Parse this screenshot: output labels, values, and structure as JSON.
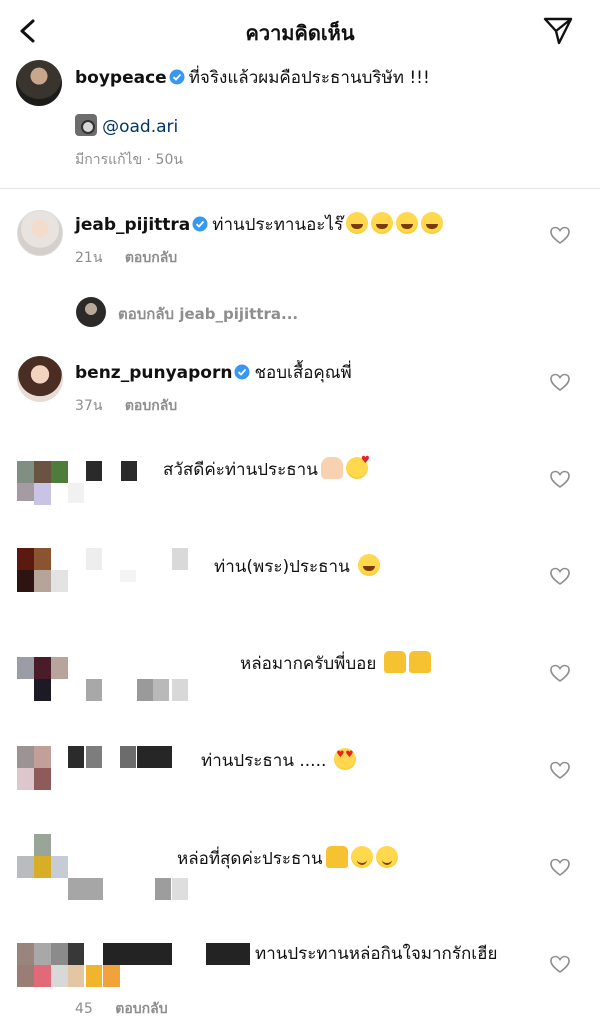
{
  "header": {
    "title": "ความคิดเห็น"
  },
  "caption": {
    "username": "boypeace",
    "text": "ที่จริงแล้วผมคือประธานบริษัท !!!",
    "mention": "@oad.ari",
    "meta": "มีการแก้ไข · 50น"
  },
  "comments": [
    {
      "username": "jeab_pijittra",
      "text": "ท่านประทานอะไร๊",
      "time": "21น",
      "reply": "ตอบกลับ"
    },
    {
      "username": "benz_punyaporn",
      "text": "ชอบเสื้อคุณพี่",
      "time": "37น",
      "reply": "ตอบกลับ"
    },
    {
      "text": "สวัสดีค่ะท่านประธาน"
    },
    {
      "text": "ท่าน(พระ)ประธาน"
    },
    {
      "text": "หล่อมากครับพี่บอย"
    },
    {
      "text": "ท่านประธาน ....."
    },
    {
      "text": "หล่อที่สุดค่ะประธาน"
    },
    {
      "text": "ทานประทานหล่อกินใจมากรักเฮีย",
      "time": "45",
      "reply": "ตอบกลับ"
    }
  ],
  "thread": {
    "reply_prefix": "ตอบกลับ",
    "reply_user": "jeab_pijittra..."
  },
  "colors": {
    "verified": "#3897f0",
    "link": "#00376b",
    "meta": "#8e8e8e"
  }
}
